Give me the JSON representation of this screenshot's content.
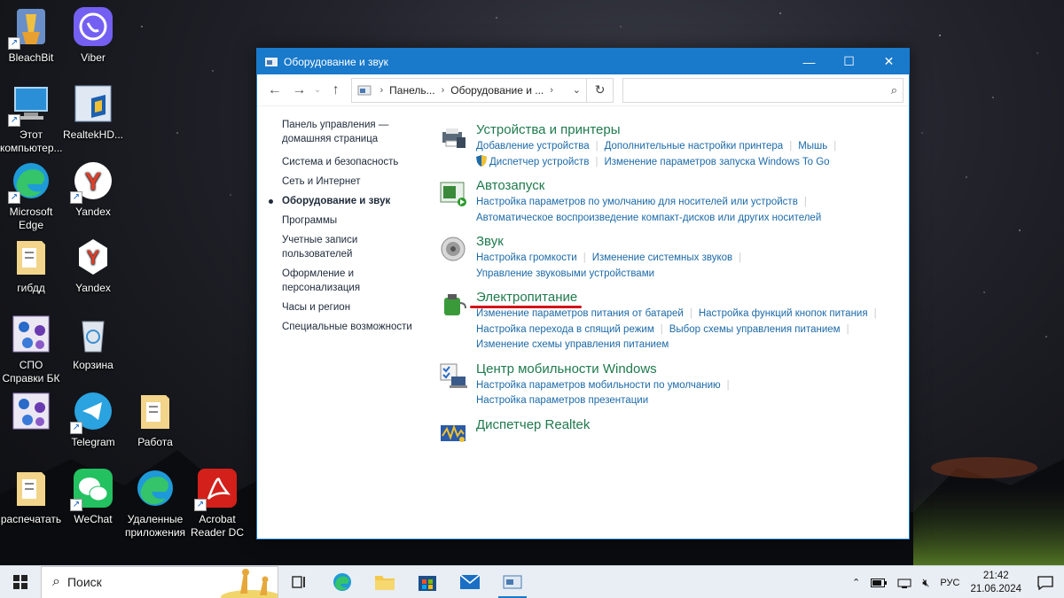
{
  "desktop": {
    "icons": [
      {
        "label": "BleachBit",
        "icon": "bleachbit-icon"
      },
      {
        "label": "Viber",
        "icon": "viber-icon"
      },
      {
        "label": "Этот компьютер...",
        "icon": "computer-icon"
      },
      {
        "label": "RealtekHD...",
        "icon": "realtek-hd-icon"
      },
      {
        "label": "Microsoft Edge",
        "icon": "edge-icon"
      },
      {
        "label": "Yandex",
        "icon": "yandex-icon"
      },
      {
        "label": "гибдд",
        "icon": "folder-icon"
      },
      {
        "label": "Yandex",
        "icon": "yandex-alt-icon"
      },
      {
        "label": "СПО Справки БК",
        "icon": "spo-icon"
      },
      {
        "label": "Корзина",
        "icon": "recycle-bin-icon"
      },
      {
        "label": "",
        "icon": "spo-shortcut-icon"
      },
      {
        "label": "Telegram",
        "icon": "telegram-icon"
      },
      {
        "label": "Работа",
        "icon": "folder-icon"
      },
      {
        "label": "распечатать",
        "icon": "folder-icon"
      },
      {
        "label": "WeChat",
        "icon": "wechat-icon"
      },
      {
        "label": "Удаленные приложения",
        "icon": "edge-icon"
      },
      {
        "label": "Acrobat Reader DC",
        "icon": "acrobat-icon"
      }
    ]
  },
  "window": {
    "title": "Оборудование и звук",
    "address": {
      "crumb1": "Панель...",
      "crumb2": "Оборудование и ..."
    },
    "search_placeholder": "",
    "left_nav": [
      {
        "label": "Панель управления — домашняя страница",
        "active": false
      },
      {
        "label": "Система и безопасность",
        "active": false
      },
      {
        "label": "Сеть и Интернет",
        "active": false
      },
      {
        "label": "Оборудование и звук",
        "active": true
      },
      {
        "label": "Программы",
        "active": false
      },
      {
        "label": "Учетные записи пользователей",
        "active": false
      },
      {
        "label": "Оформление и персонализация",
        "active": false
      },
      {
        "label": "Часы и регион",
        "active": false
      },
      {
        "label": "Специальные возможности",
        "active": false
      }
    ],
    "categories": [
      {
        "title": "Устройства и принтеры",
        "icon": "devices-printers-icon",
        "lines": [
          [
            "Добавление устройства",
            "Дополнительные настройки принтера",
            "Мышь"
          ],
          [
            "Диспетчер устройств",
            "Изменение параметров запуска Windows To Go"
          ]
        ]
      },
      {
        "title": "Автозапуск",
        "icon": "autoplay-icon",
        "lines": [
          [
            "Настройка параметров по умолчанию для носителей или устройств"
          ],
          [
            "Автоматическое воспроизведение компакт-дисков или других носителей"
          ]
        ]
      },
      {
        "title": "Звук",
        "icon": "sound-icon",
        "lines": [
          [
            "Настройка громкости",
            "Изменение системных звуков"
          ],
          [
            "Управление звуковыми устройствами"
          ]
        ]
      },
      {
        "title": "Электропитание",
        "icon": "power-options-icon",
        "lines": [
          [
            "Изменение параметров питания от батарей",
            "Настройка функций кнопок питания"
          ],
          [
            "Настройка перехода в спящий режим",
            "Выбор схемы управления питанием"
          ],
          [
            "Изменение схемы управления питанием"
          ]
        ]
      },
      {
        "title": "Центр мобильности Windows",
        "icon": "mobility-center-icon",
        "lines": [
          [
            "Настройка параметров мобильности по умолчанию"
          ],
          [
            "Настройка параметров презентации"
          ]
        ]
      },
      {
        "title": "Диспетчер Realtek",
        "icon": "realtek-manager-icon",
        "lines": []
      }
    ]
  },
  "taskbar": {
    "search_text": "Поиск",
    "lang": "РУС",
    "time": "21:42",
    "date": "21.06.2024"
  }
}
